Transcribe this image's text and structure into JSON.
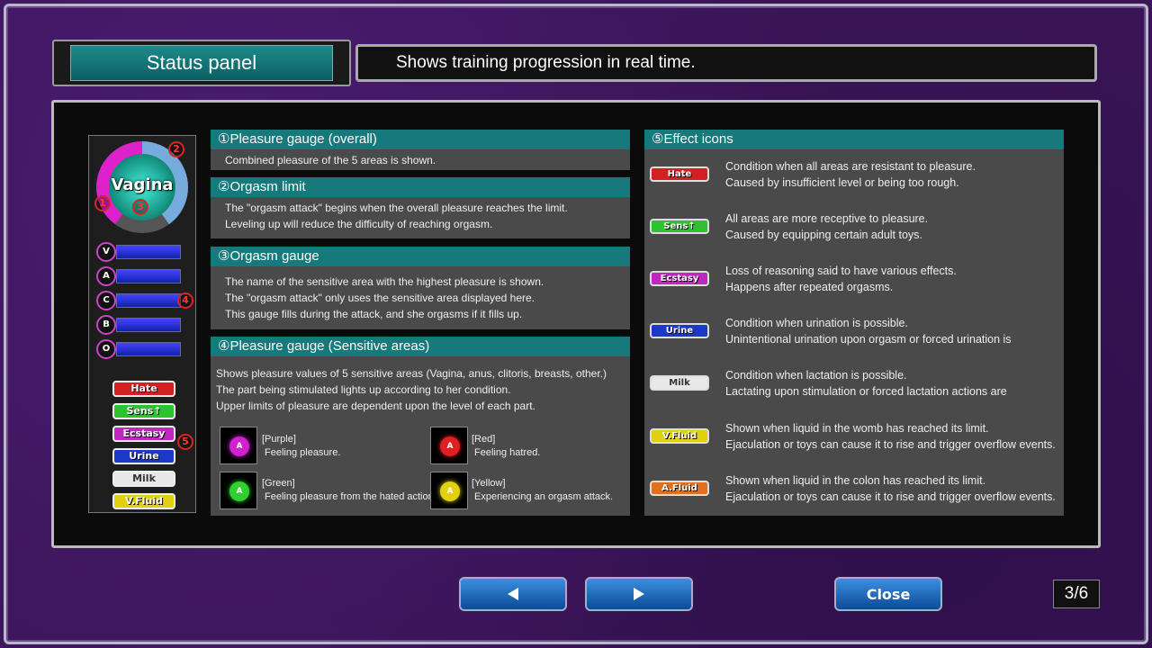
{
  "header": {
    "title": "Status panel",
    "description": "Shows training progression in real time."
  },
  "status_panel": {
    "area_name": "Vagina",
    "markers": [
      "1",
      "2",
      "3",
      "4",
      "5"
    ],
    "bars": [
      {
        "letter": "V"
      },
      {
        "letter": "A"
      },
      {
        "letter": "C"
      },
      {
        "letter": "B"
      },
      {
        "letter": "O"
      }
    ],
    "effects": [
      {
        "label": "Hate",
        "color": "#d32020"
      },
      {
        "label": "Sens↑",
        "color": "#2fc22f"
      },
      {
        "label": "Ecstasy",
        "color": "#c026c0"
      },
      {
        "label": "Urine",
        "color": "#1c38c8"
      },
      {
        "label": "Milk",
        "color": "#e8e8e8"
      },
      {
        "label": "V.Fluid",
        "color": "#e0d010"
      }
    ]
  },
  "sections": [
    {
      "title": "①Pleasure gauge (overall)",
      "lines": [
        "Combined pleasure of the 5 areas is shown."
      ]
    },
    {
      "title": "②Orgasm limit",
      "lines": [
        "The \"orgasm attack\" begins when the overall pleasure reaches the limit.",
        "Leveling up will reduce the difficulty of reaching orgasm."
      ]
    },
    {
      "title": "③Orgasm gauge",
      "lines": [
        "The name of the sensitive area with the highest pleasure is shown.",
        "The \"orgasm attack\" only uses the sensitive area displayed here.",
        "This gauge fills during the attack, and she orgasms if it fills up."
      ]
    },
    {
      "title": "④Pleasure gauge (Sensitive areas)",
      "lines": [
        "Shows pleasure values of 5 sensitive areas (Vagina, anus, clitoris, breasts, other.)",
        "The part being stimulated lights up according to her condition.",
        "Upper limits of pleasure are dependent upon the level of each part."
      ]
    }
  ],
  "gauge_states": [
    {
      "color_label": "[Purple]",
      "desc": "Feeling pleasure.",
      "color": "#d020d0",
      "letter": "A"
    },
    {
      "color_label": "[Red]",
      "desc": "Feeling hatred.",
      "color": "#e02020",
      "letter": "A"
    },
    {
      "color_label": "[Green]",
      "desc": "Feeling pleasure from the hated action.",
      "color": "#30d030",
      "letter": "A"
    },
    {
      "color_label": "[Yellow]",
      "desc": "Experiencing an orgasm attack.",
      "color": "#e0d010",
      "letter": "A"
    }
  ],
  "effect_icons": {
    "title": "⑤Effect icons",
    "items": [
      {
        "label": "Hate",
        "color": "#d32020",
        "lines": [
          "Condition when all areas are resistant to pleasure.",
          "Caused by insufficient level or being too rough."
        ]
      },
      {
        "label": "Sens↑",
        "color": "#2fc22f",
        "lines": [
          "All areas are more receptive to pleasure.",
          "Caused by equipping certain adult toys."
        ]
      },
      {
        "label": "Ecstasy",
        "color": "#c026c0",
        "lines": [
          "Loss of reasoning said to have various effects.",
          "Happens after repeated orgasms."
        ]
      },
      {
        "label": "Urine",
        "color": "#1c38c8",
        "lines": [
          "Condition when urination is possible.",
          "Unintentional urination upon orgasm or forced urination is"
        ]
      },
      {
        "label": "Milk",
        "color": "#e8e8e8",
        "lines": [
          "Condition when lactation is possible.",
          "Lactating upon stimulation or forced lactation actions are"
        ]
      },
      {
        "label": "V.Fluid",
        "color": "#e0d010",
        "lines": [
          "Shown when liquid in the womb has reached its limit.",
          "Ejaculation or toys can cause it to rise and trigger overflow events."
        ]
      },
      {
        "label": "A.Fluid",
        "color": "#e07020",
        "lines": [
          "Shown when liquid in the colon has reached its limit.",
          "Ejaculation or toys can cause it to rise and trigger overflow events."
        ]
      }
    ]
  },
  "nav": {
    "close_label": "Close",
    "page_indicator": "3/6"
  }
}
